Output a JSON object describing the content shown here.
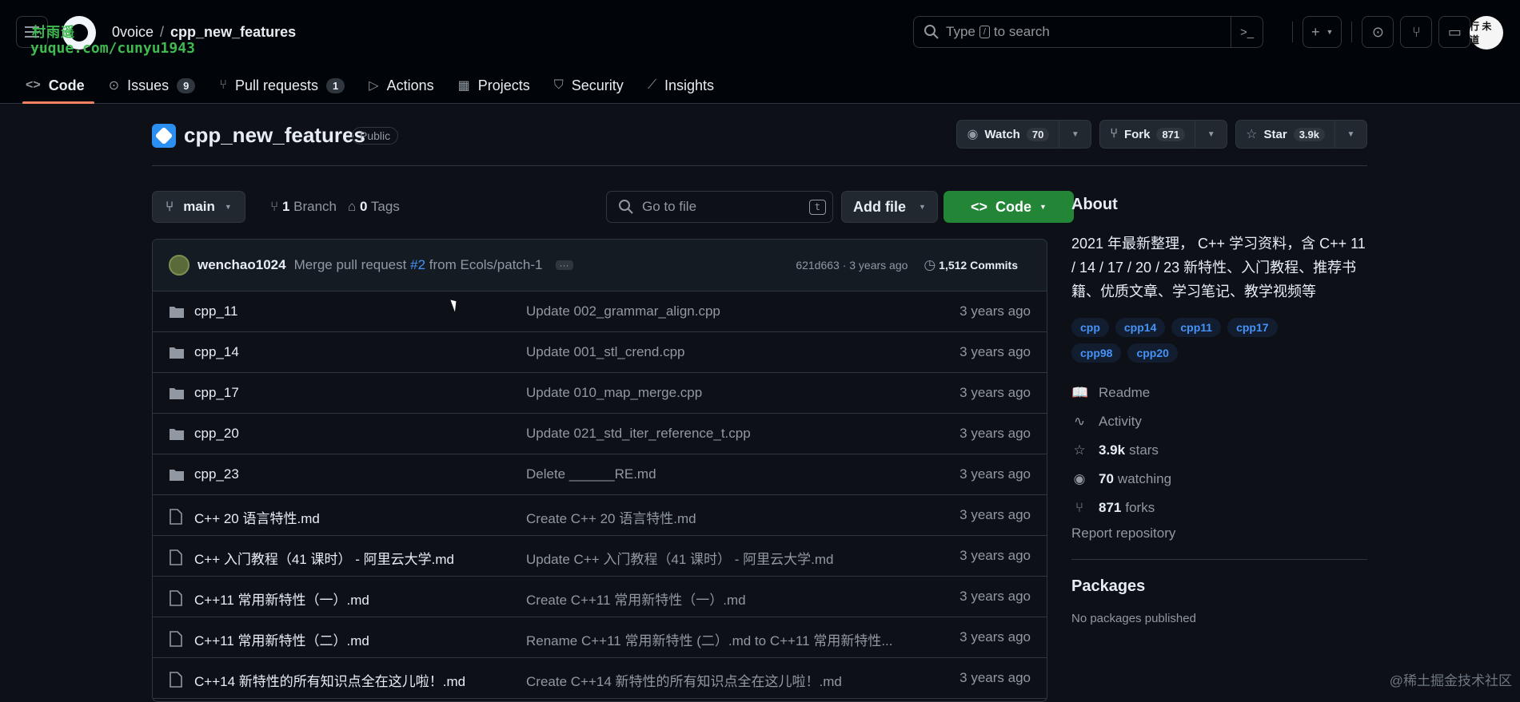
{
  "header": {
    "owner": "0voice",
    "repo": "cpp_new_features",
    "search_placeholder": "Type",
    "search_key": "/",
    "search_suffix": "to search",
    "avatar_text": "行 未 道"
  },
  "watermark": {
    "line1": "村雨遥",
    "line2": "yuque.com/cunyu1943",
    "corner": "@稀土掘金技术社区"
  },
  "tabs": [
    {
      "label": "Code",
      "count": ""
    },
    {
      "label": "Issues",
      "count": "9"
    },
    {
      "label": "Pull requests",
      "count": "1"
    },
    {
      "label": "Actions",
      "count": ""
    },
    {
      "label": "Projects",
      "count": ""
    },
    {
      "label": "Security",
      "count": ""
    },
    {
      "label": "Insights",
      "count": ""
    }
  ],
  "repo": {
    "name": "cpp_new_features",
    "visibility": "Public",
    "watch_label": "Watch",
    "watch_count": "70",
    "fork_label": "Fork",
    "fork_count": "871",
    "star_label": "Star",
    "star_count": "3.9k"
  },
  "branch": {
    "name": "main",
    "branch_count": "1",
    "branch_label": "Branch",
    "tag_count": "0",
    "tag_label": "Tags",
    "goto_placeholder": "Go to file",
    "goto_key": "t",
    "addfile_label": "Add file",
    "code_label": "Code"
  },
  "commit": {
    "author": "wenchao1024",
    "msg_prefix": "Merge pull request",
    "pr": "#2",
    "msg_suffix": "from Ecols/patch-1",
    "hash_time": "621d663 · 3 years ago",
    "commits_count": "1,512",
    "commits_label": "Commits"
  },
  "files": [
    {
      "name": "cpp_11",
      "type": "dir",
      "msg": "Update 002_grammar_align.cpp",
      "time": "3 years ago"
    },
    {
      "name": "cpp_14",
      "type": "dir",
      "msg": "Update 001_stl_crend.cpp",
      "time": "3 years ago"
    },
    {
      "name": "cpp_17",
      "type": "dir",
      "msg": "Update 010_map_merge.cpp",
      "time": "3 years ago"
    },
    {
      "name": "cpp_20",
      "type": "dir",
      "msg": "Update 021_std_iter_reference_t.cpp",
      "time": "3 years ago"
    },
    {
      "name": "cpp_23",
      "type": "dir",
      "msg": "Delete ______RE.md",
      "time": "3 years ago"
    },
    {
      "name": "C++ 20 语言特性.md",
      "type": "file",
      "msg": "Create C++ 20 语言特性.md",
      "time": "3 years ago"
    },
    {
      "name": "C++ 入门教程（41 课时） - 阿里云大学.md",
      "type": "file",
      "msg": "Update C++ 入门教程（41 课时） - 阿里云大学.md",
      "time": "3 years ago"
    },
    {
      "name": "C++11 常用新特性（一）.md",
      "type": "file",
      "msg": "Create C++11 常用新特性（一）.md",
      "time": "3 years ago"
    },
    {
      "name": "C++11 常用新特性（二）.md",
      "type": "file",
      "msg": "Rename C++11 常用新特性 (二）.md to C++11 常用新特性...",
      "time": "3 years ago"
    },
    {
      "name": "C++14 新特性的所有知识点全在这儿啦！.md",
      "type": "file",
      "msg": "Create C++14 新特性的所有知识点全在这儿啦！.md",
      "time": "3 years ago"
    }
  ],
  "about": {
    "title": "About",
    "description": "2021 年最新整理， C++ 学习资料，含 C++ 11 / 14 / 17 / 20 / 23 新特性、入门教程、推荐书籍、优质文章、学习笔记、教学视频等",
    "topics": [
      "cpp",
      "cpp14",
      "cpp11",
      "cpp17",
      "cpp98",
      "cpp20"
    ],
    "readme": "Readme",
    "activity": "Activity",
    "stars_count": "3.9k",
    "stars_label": "stars",
    "watching_count": "70",
    "watching_label": "watching",
    "forks_count": "871",
    "forks_label": "forks",
    "report": "Report repository"
  },
  "packages": {
    "title": "Packages",
    "none": "No packages published"
  },
  "colors": {
    "accent_green": "#238636",
    "link_blue": "#4493f8",
    "tab_underline": "#f78166"
  }
}
